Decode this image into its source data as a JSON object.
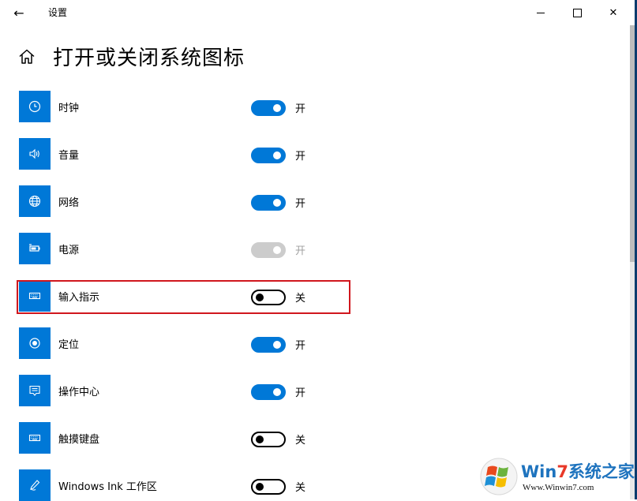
{
  "window": {
    "title": "设置",
    "back_icon": "←",
    "close_icon": "✕"
  },
  "header": {
    "title": "打开或关闭系统图标"
  },
  "items": [
    {
      "label": "时钟",
      "icon": "clock-icon",
      "state": "on",
      "state_text": "开"
    },
    {
      "label": "音量",
      "icon": "volume-icon",
      "state": "on",
      "state_text": "开"
    },
    {
      "label": "网络",
      "icon": "network-icon",
      "state": "on",
      "state_text": "开"
    },
    {
      "label": "电源",
      "icon": "battery-icon",
      "state": "disabled-on",
      "state_text": "开"
    },
    {
      "label": "输入指示",
      "icon": "keyboard-icon",
      "state": "off",
      "state_text": "关",
      "highlighted": true
    },
    {
      "label": "定位",
      "icon": "location-icon",
      "state": "on",
      "state_text": "开"
    },
    {
      "label": "操作中心",
      "icon": "action-center-icon",
      "state": "on",
      "state_text": "开"
    },
    {
      "label": "触摸键盘",
      "icon": "keyboard-icon",
      "state": "off",
      "state_text": "关"
    },
    {
      "label": "Windows Ink 工作区",
      "icon": "pen-icon",
      "state": "off",
      "state_text": "关"
    }
  ],
  "watermark": {
    "brand_win": "Win",
    "brand_7": "7",
    "brand_rest": "系统之家",
    "url": "Www.Winwin7.com"
  },
  "colors": {
    "accent": "#0078d7",
    "highlight_border": "#d0171e",
    "disabled": "#cccccc"
  }
}
